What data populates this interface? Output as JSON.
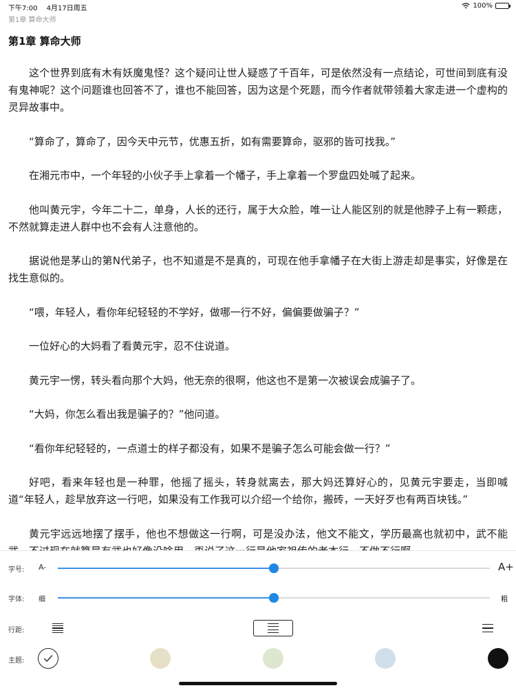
{
  "status_bar": {
    "time": "下午7:00",
    "date": "4月17日周五",
    "battery": "100%",
    "battery_level": 1.0
  },
  "breadcrumb": "第1章 算命大师",
  "chapter_title": "第1章 算命大师",
  "paragraphs": [
    "这个世界到底有木有妖魔鬼怪？这个疑问让世人疑惑了千百年，可是依然没有一点结论，可世间到底有没有鬼神呢？这个问题谁也回答不了，谁也不能回答，因为这是个死题，而今作者就带领着大家走进一个虚构的灵异故事中。",
    "“算命了，算命了，因今天中元节，优惠五折，如有需要算命，驱邪的皆可找我。”",
    "在湘元市中，一个年轻的小伙子手上拿着一个幡子，手上拿着一个罗盘四处喊了起来。",
    "他叫黄元宇，今年二十二，单身，人长的还行，属于大众脸，唯一让人能区别的就是他脖子上有一颗痣，不然就算走进人群中也不会有人注意他的。",
    "据说他是茅山的第N代弟子，也不知道是不是真的，可现在他手拿幡子在大街上游走却是事实，好像是在找生意似的。",
    "“喂，年轻人，看你年纪轻轻的不学好，做哪一行不好，偏偏要做骗子？”",
    "一位好心的大妈看了看黄元宇，忍不住说道。",
    "黄元宇一愣，转头看向那个大妈，他无奈的很啊，他这也不是第一次被误会成骗子了。",
    "“大妈，你怎么看出我是骗子的？”他问道。",
    "“看你年纪轻轻的，一点道士的样子都没有，如果不是骗子怎么可能会做一行？”",
    "好吧，看来年轻也是一种罪，他摇了摇头，转身就离去，那大妈还算好心的，见黄元宇要走，当即喊道“年轻人，趁早放弃这一行吧，如果没有工作我可以介绍一个给你，搬砖，一天好歹也有两百块钱。”",
    "黄元宇远远地摆了摆手，他也不想做这一行啊，可是没办法，他文不能文，学历最高也就初中，武不能武，不过现在就算是有武也好像没啥用，再说了这一行是他家祖传的老本行，不做不行啊。"
  ],
  "settings": {
    "font_size": {
      "label": "字号:",
      "decrease": "A-",
      "increase": "A+",
      "value": 0.5
    },
    "font_weight": {
      "label": "字体:",
      "min_label": "细",
      "max_label": "粗",
      "value": 0.5
    },
    "line_spacing": {
      "label": "行距:",
      "options": [
        "compact",
        "normal",
        "loose"
      ],
      "selected": "normal"
    },
    "theme": {
      "label": "主题:",
      "options": [
        {
          "name": "white",
          "color": "#ffffff",
          "selected": true
        },
        {
          "name": "beige",
          "color": "#e6e0c6",
          "selected": false
        },
        {
          "name": "green",
          "color": "#dde6cf",
          "selected": false
        },
        {
          "name": "blue",
          "color": "#d1dfea",
          "selected": false
        },
        {
          "name": "black",
          "color": "#111111",
          "selected": false
        }
      ]
    },
    "accent_color": "#1e88e5"
  }
}
